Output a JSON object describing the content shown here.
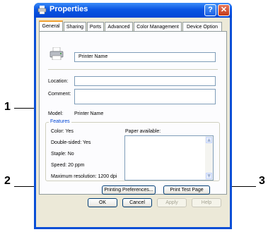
{
  "window": {
    "title": "Properties",
    "tabs": [
      "General",
      "Sharing",
      "Ports",
      "Advanced",
      "Color Management",
      "Device Option"
    ],
    "active_tab": "General"
  },
  "general": {
    "printer_name": "Printer Name",
    "location_label": "Location:",
    "location_value": "",
    "comment_label": "Comment:",
    "comment_value": "",
    "model_label": "Model:",
    "model_value": "Printer Name"
  },
  "features": {
    "group_title": "Features",
    "color": "Color: Yes",
    "double_sided": "Double-sided: Yes",
    "staple": "Staple: No",
    "speed": "Speed: 20 ppm",
    "max_resolution": "Maximum resolution: 1200 dpi",
    "paper_available_label": "Paper available:"
  },
  "buttons": {
    "printing_preferences": "Printing Preferences...",
    "print_test_page": "Print Test Page",
    "ok": "OK",
    "cancel": "Cancel",
    "apply": "Apply",
    "help": "Help"
  },
  "callouts": [
    "1",
    "2",
    "3"
  ],
  "colors": {
    "titlebar": "#0a55e3",
    "dialog_face": "#ece9d8",
    "group_title": "#0046d5",
    "active_tab_accent": "#f0a030"
  },
  "icons": [
    "printer-properties-icon",
    "help-icon",
    "close-icon",
    "printer-icon",
    "scroll-up-icon",
    "scroll-down-icon"
  ]
}
